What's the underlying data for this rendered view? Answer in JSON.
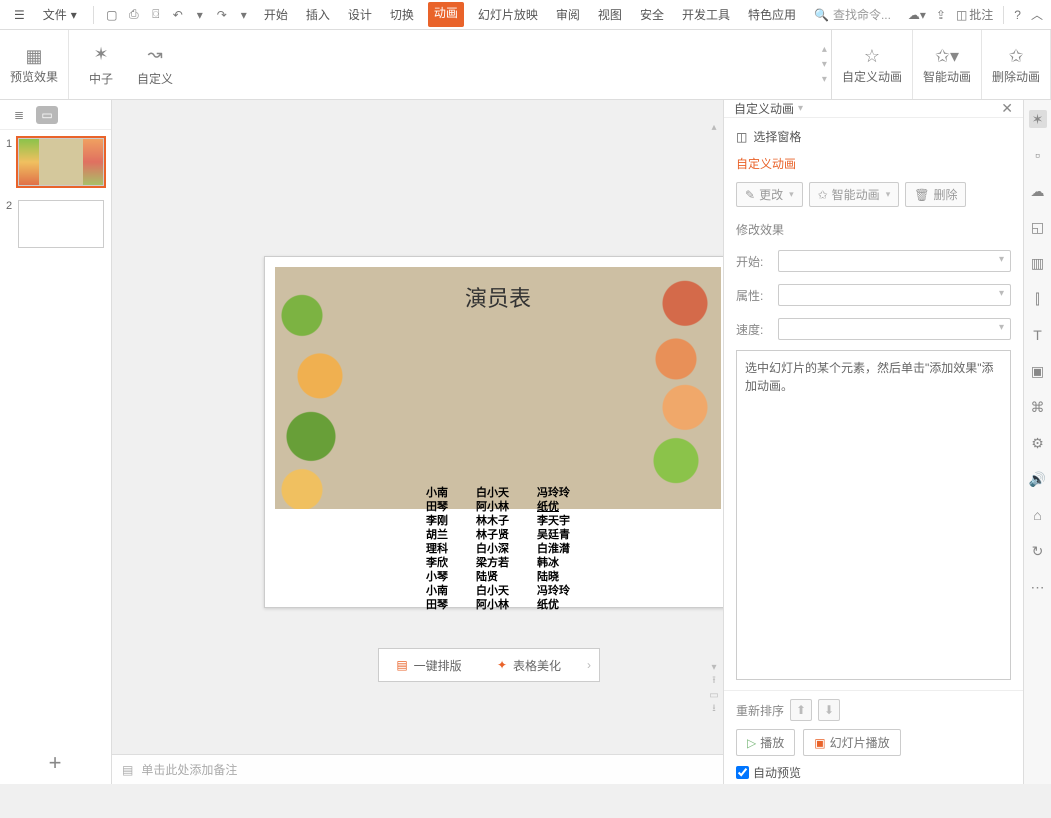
{
  "topbar": {
    "file_label": "文件",
    "tabs": [
      "开始",
      "插入",
      "设计",
      "切换",
      "动画",
      "幻灯片放映",
      "审阅",
      "视图",
      "安全",
      "开发工具",
      "特色应用"
    ],
    "active_tab_index": 4,
    "search_placeholder": "查找命令...",
    "annotate_label": "批注"
  },
  "ribbon": {
    "preview": "预览效果",
    "neutron": "中子",
    "custom": "自定义",
    "custom_anim": "自定义动画",
    "smart_anim": "智能动画",
    "delete_anim": "删除动画"
  },
  "thumbs": {
    "slides": [
      {
        "num": "1",
        "selected": true,
        "leaf": true
      },
      {
        "num": "2",
        "selected": false,
        "leaf": false
      }
    ]
  },
  "slide": {
    "title": "演员表",
    "credits_col1": [
      "小南",
      "田琴",
      "李刚",
      "胡兰",
      "理科",
      "李欣",
      "小琴",
      "小南",
      "田琴"
    ],
    "credits_col2": [
      "白小天",
      "阿小林",
      "林木子",
      "林子贤",
      "白小深",
      "梁方若",
      "陆贤",
      "白小天",
      "阿小林"
    ],
    "credits_col3": [
      "冯玲玲",
      "纸优",
      "李天宇",
      "吴廷青",
      "白淮潸",
      "韩冰",
      "陆晓",
      "冯玲玲",
      "纸优"
    ],
    "col3_underline": [
      1
    ]
  },
  "quickbar": {
    "layout": "一键排版",
    "beautify": "表格美化"
  },
  "notes_placeholder": "单击此处添加备注",
  "side_panel": {
    "title": "自定义动画",
    "select_pane": "选择窗格",
    "section": "自定义动画",
    "btn_change": "更改",
    "btn_smart": "智能动画",
    "btn_delete": "删除",
    "modify_title": "修改效果",
    "lbl_start": "开始:",
    "lbl_prop": "属性:",
    "lbl_speed": "速度:",
    "info_text": "选中幻灯片的某个元素，然后单击\"添加效果\"添加动画。",
    "reorder": "重新排序",
    "play": "播放",
    "slideshow": "幻灯片播放",
    "auto_preview": "自动预览"
  }
}
